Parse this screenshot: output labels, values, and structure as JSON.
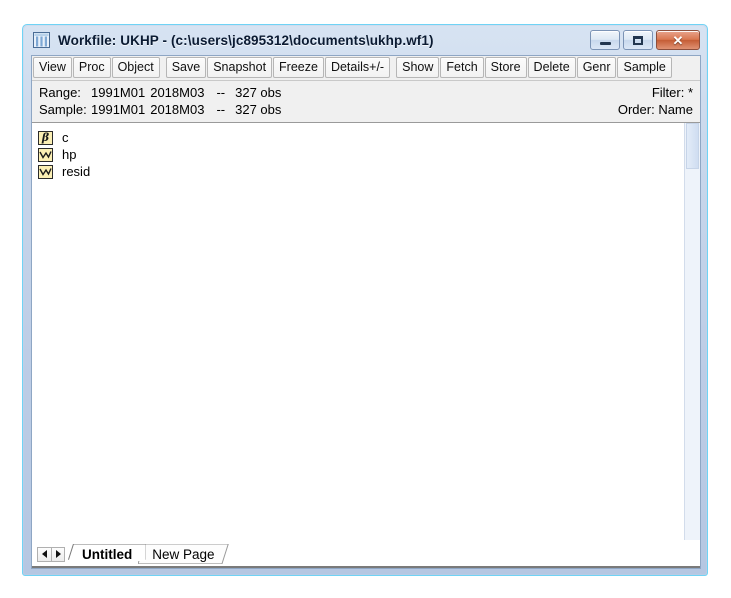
{
  "window": {
    "title": "Workfile: UKHP - (c:\\users\\jc895312\\documents\\ukhp.wf1)",
    "icon": "workfile-grid-icon",
    "controls": {
      "minimize_label": "–",
      "maximize_label": "□",
      "close_label": "✕"
    }
  },
  "toolbar": {
    "group1": [
      {
        "label": "View",
        "name": "view-button"
      },
      {
        "label": "Proc",
        "name": "proc-button"
      },
      {
        "label": "Object",
        "name": "object-button"
      }
    ],
    "group2": [
      {
        "label": "Save",
        "name": "save-button"
      },
      {
        "label": "Snapshot",
        "name": "snapshot-button"
      },
      {
        "label": "Freeze",
        "name": "freeze-button"
      },
      {
        "label": "Details+/-",
        "name": "details-toggle-button"
      }
    ],
    "group3": [
      {
        "label": "Show",
        "name": "show-button"
      },
      {
        "label": "Fetch",
        "name": "fetch-button"
      },
      {
        "label": "Store",
        "name": "store-button"
      },
      {
        "label": "Delete",
        "name": "delete-button"
      },
      {
        "label": "Genr",
        "name": "genr-button"
      },
      {
        "label": "Sample",
        "name": "sample-button"
      }
    ]
  },
  "info": {
    "range": {
      "label": "Range:",
      "start": "1991M01",
      "end": "2018M03",
      "dash": "--",
      "obs": "327 obs"
    },
    "sample": {
      "label": "Sample:",
      "start": "1991M01",
      "end": "2018M03",
      "dash": "--",
      "obs": "327 obs"
    },
    "filter": "Filter: *",
    "order": "Order: Name"
  },
  "objects": [
    {
      "name": "c",
      "icon": "coef-beta-icon",
      "type": "coef"
    },
    {
      "name": "hp",
      "icon": "series-curve-icon",
      "type": "series"
    },
    {
      "name": "resid",
      "icon": "series-curve-icon",
      "type": "series"
    }
  ],
  "tabs": {
    "nav_prev": "◀",
    "nav_next": "▶",
    "items": [
      {
        "label": "Untitled",
        "active": true
      },
      {
        "label": "New Page",
        "active": false
      }
    ]
  },
  "colors": {
    "frame_glass": "#bdcde6",
    "frame_edge": "#6fd3f5",
    "toolbar_bg": "#f0f0f0",
    "info_bg": "#f0f0f0",
    "icon_fill": "#fbefb4",
    "close_button": "#d9764f"
  }
}
